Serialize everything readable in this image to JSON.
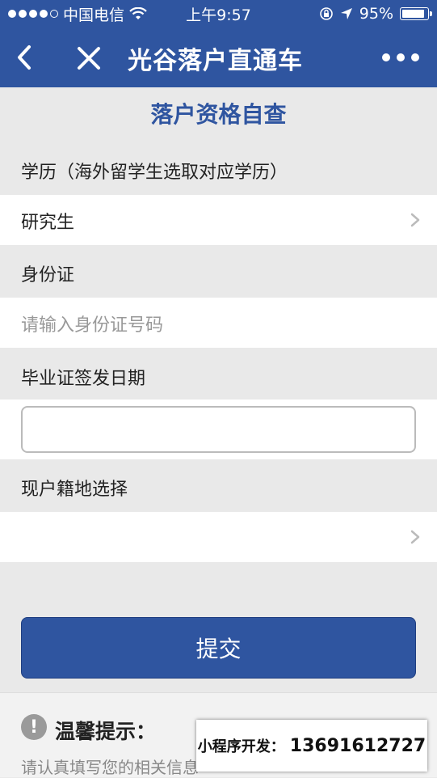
{
  "status": {
    "carrier": "中国电信",
    "time": "上午9:57",
    "battery": "95%",
    "battery_level": 0.95
  },
  "nav": {
    "title": "光谷落户直通车"
  },
  "form": {
    "section_title": "落户资格自查",
    "education_label": "学历（海外留学生选取对应学历）",
    "education_value": "研究生",
    "id_label": "身份证",
    "id_placeholder": "请输入身份证号码",
    "grad_date_label": "毕业证签发日期",
    "grad_date_value": "",
    "hukou_label": "现户籍地选择",
    "hukou_value": "",
    "submit_label": "提交"
  },
  "tips": {
    "title": "温馨提示：",
    "text": "请认真填写您的相关信息"
  },
  "contact": {
    "label": "小程序开发：",
    "phone": "13691612727"
  },
  "colors": {
    "primary": "#2f55a0",
    "background": "#e9e9e9"
  }
}
